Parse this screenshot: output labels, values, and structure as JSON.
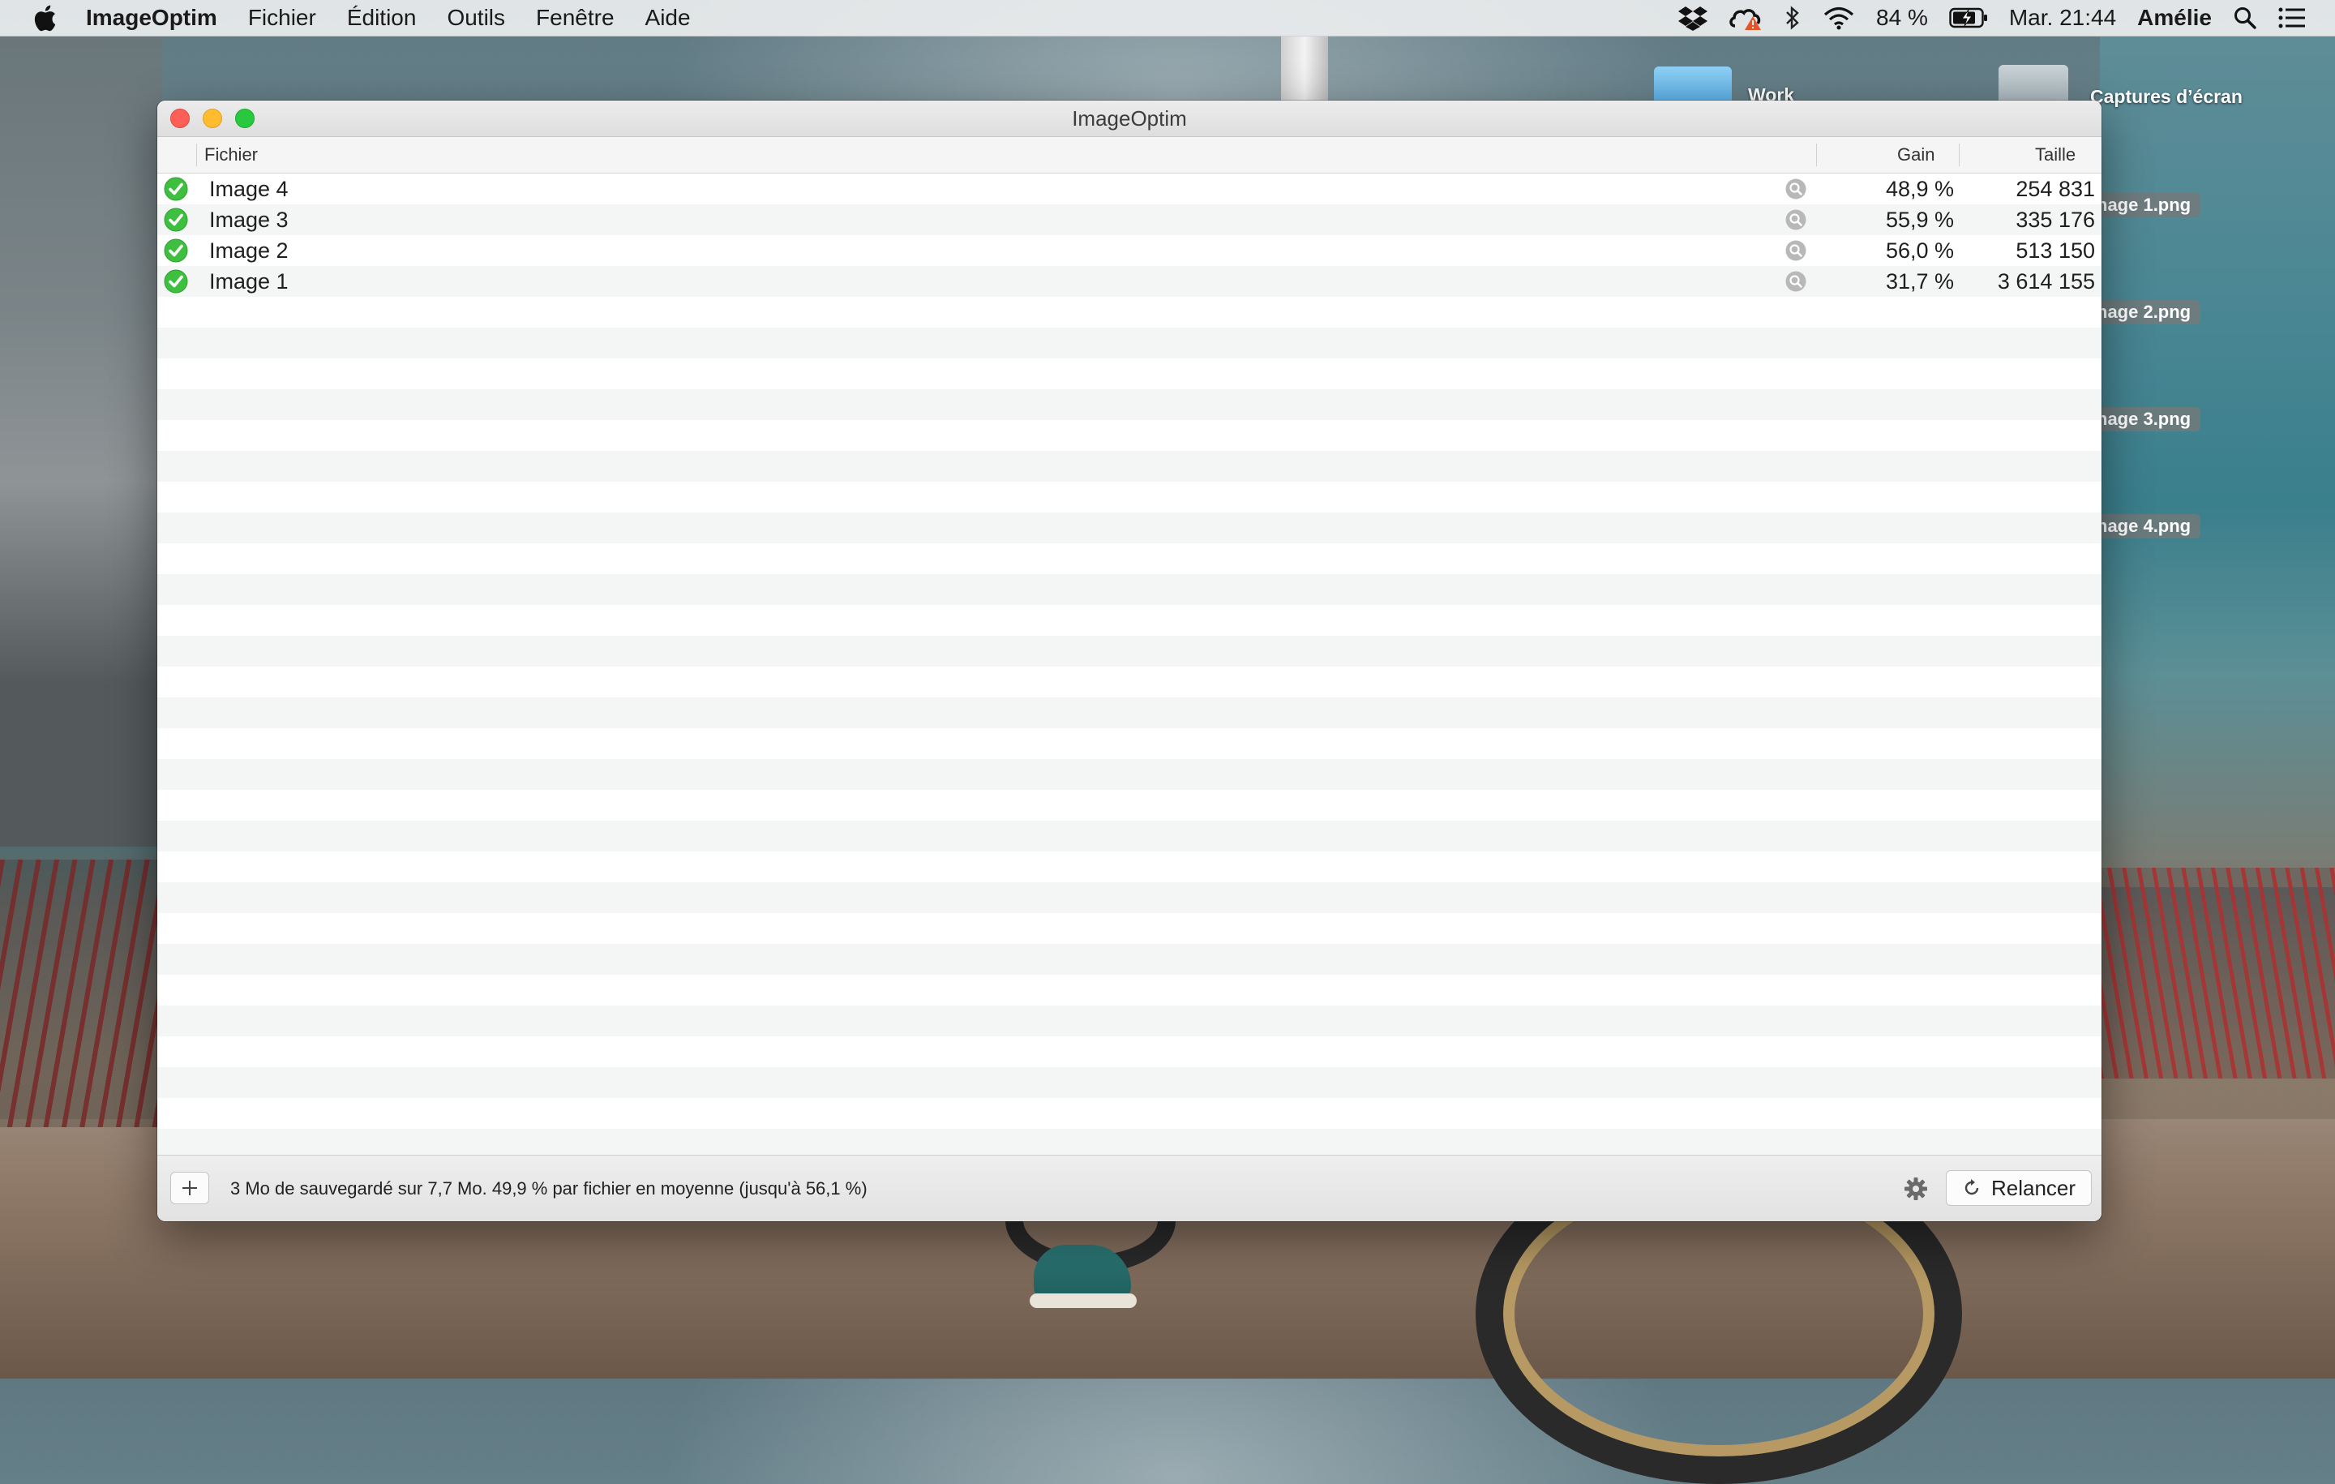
{
  "menubar": {
    "app_name": "ImageOptim",
    "menus": [
      "Fichier",
      "Édition",
      "Outils",
      "Fenêtre",
      "Aide"
    ],
    "battery": "84 %",
    "clock": "Mar. 21:44",
    "user": "Amélie",
    "status_icons": [
      "dropbox-icon",
      "creative-cloud-icon",
      "bluetooth-icon",
      "wifi-icon",
      "battery-icon",
      "spotlight-icon",
      "notification-center-icon"
    ]
  },
  "desktop": {
    "folders": [
      "Work",
      "Captures d’écran"
    ],
    "files": [
      "nage 1.png",
      "nage 2.png",
      "nage 3.png",
      "nage 4.png"
    ]
  },
  "window": {
    "title": "ImageOptim",
    "columns": {
      "file": "Fichier",
      "gain": "Gain",
      "size": "Taille"
    },
    "rows": [
      {
        "name": "Image 4",
        "gain": "48,9 %",
        "size": "254 831",
        "status": "done"
      },
      {
        "name": "Image 3",
        "gain": "55,9 %",
        "size": "335 176",
        "status": "done"
      },
      {
        "name": "Image 2",
        "gain": "56,0 %",
        "size": "513 150",
        "status": "done"
      },
      {
        "name": "Image 1",
        "gain": "31,7 %",
        "size": "3 614 155",
        "status": "done"
      }
    ],
    "footer": {
      "add_label": "+",
      "summary": "3 Mo de sauvegardé sur 7,7 Mo. 49,9 % par fichier en moyenne (jusqu'à 56,1 %)",
      "relaunch_label": "Relancer"
    }
  },
  "colors": {
    "accent_green": "#3fbf3f",
    "close": "#fe5f57",
    "minimize": "#febc2e",
    "maximize": "#28c840"
  }
}
